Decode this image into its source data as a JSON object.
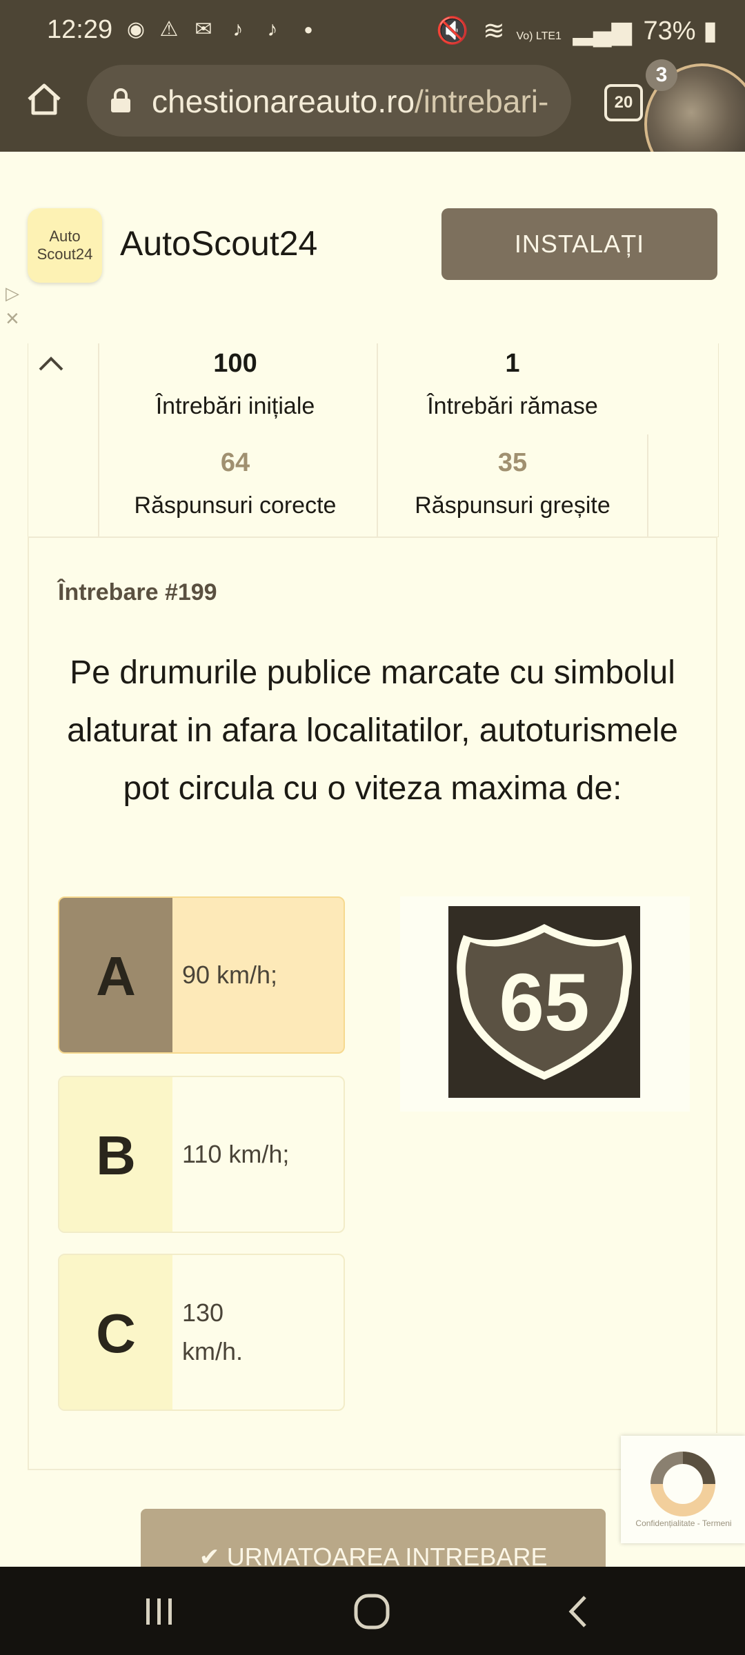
{
  "status_bar": {
    "time": "12:29",
    "battery": "73%",
    "network": "Vo) LTE1"
  },
  "browser": {
    "url_host": "chestionareauto.ro",
    "url_path": "/intrebari-",
    "tab_count": "20",
    "avatar_badge": "3"
  },
  "ad": {
    "logo_line1": "Auto",
    "logo_line2": "Scout24",
    "title": "AutoScout24",
    "install_label": "INSTALAȚI"
  },
  "stats": {
    "initial_value": "100",
    "initial_label": "Întrebări inițiale",
    "remaining_value": "1",
    "remaining_label": "Întrebări rămase",
    "correct_value": "64",
    "correct_label": "Răspunsuri corecte",
    "wrong_value": "35",
    "wrong_label": "Răspunsuri greșite"
  },
  "question": {
    "number": "Întrebare #199",
    "text": "Pe drumurile publice marcate cu simbolul alaturat in afara localitatilor, autoturismele pot circula cu o viteza maxima de:",
    "answers": [
      {
        "letter": "A",
        "text": "90 km/h;"
      },
      {
        "letter": "B",
        "text": "110 km/h;"
      },
      {
        "letter": "C",
        "text": "130 km/h."
      }
    ],
    "sign_number": "65"
  },
  "recaptcha": {
    "terms": "Confidențialitate - Termeni"
  },
  "next_button": {
    "label": "URMATOAREA INTREBARE"
  }
}
